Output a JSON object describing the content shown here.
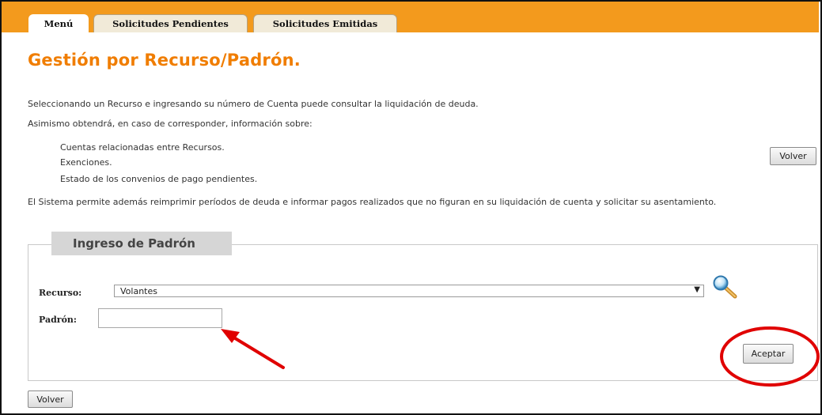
{
  "tabs": [
    {
      "label": "Menú",
      "active": true
    },
    {
      "label": "Solicitudes Pendientes",
      "active": false
    },
    {
      "label": "Solicitudes Emitidas",
      "active": false
    }
  ],
  "page_title": "Gestión por Recurso/Padrón.",
  "intro": {
    "p1": "Seleccionando un Recurso e ingresando su número de Cuenta puede consultar la liquidación de deuda.",
    "p2": "Asimismo obtendrá, en caso de corresponder, información sobre:",
    "items": [
      "Cuentas relacionadas entre Recursos.",
      "Exenciones.",
      "Estado de los convenios de pago pendientes."
    ],
    "p3": "El Sistema permite además reimprimir períodos de deuda e informar pagos realizados que no figuran en su liquidación de cuenta y solicitar su asentamiento."
  },
  "buttons": {
    "volver_top": "Volver",
    "volver_bottom": "Volver",
    "aceptar": "Aceptar"
  },
  "form": {
    "legend": "Ingreso de Padrón",
    "recurso_label": "Recurso:",
    "recurso_value": "Volantes",
    "padron_label": "Padrón:",
    "padron_value": ""
  },
  "colors": {
    "brand_orange": "#f39a1d",
    "title_orange": "#f07d00",
    "annotation_red": "#e00000"
  }
}
